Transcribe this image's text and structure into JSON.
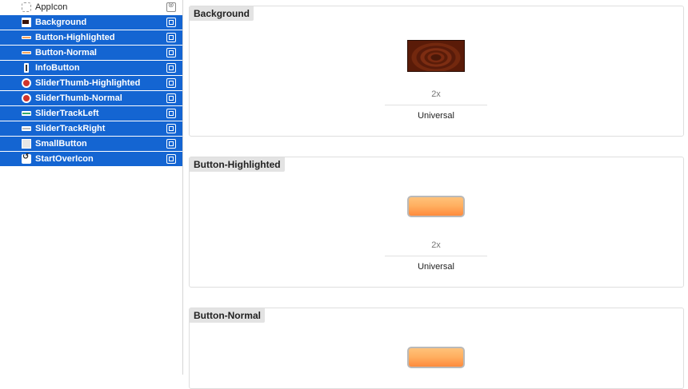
{
  "sidebar": {
    "items": [
      {
        "label": "AppIcon",
        "icon": "app-icon-placeholder",
        "selected": false
      },
      {
        "label": "Background",
        "icon": "background-image-icon",
        "selected": true
      },
      {
        "label": "Button-Highlighted",
        "icon": "button-image-icon",
        "selected": true
      },
      {
        "label": "Button-Normal",
        "icon": "button-image-icon",
        "selected": true
      },
      {
        "label": "InfoButton",
        "icon": "info-button-icon",
        "selected": true
      },
      {
        "label": "SliderThumb-Highlighted",
        "icon": "slider-thumb-icon",
        "selected": true
      },
      {
        "label": "SliderThumb-Normal",
        "icon": "slider-thumb-icon",
        "selected": true
      },
      {
        "label": "SliderTrackLeft",
        "icon": "slider-track-icon",
        "selected": true
      },
      {
        "label": "SliderTrackRight",
        "icon": "slider-track-icon",
        "selected": true
      },
      {
        "label": "SmallButton",
        "icon": "small-button-icon",
        "selected": true
      },
      {
        "label": "StartOverIcon",
        "icon": "start-over-icon",
        "selected": true
      }
    ]
  },
  "main": {
    "sets": [
      {
        "title": "Background",
        "scale": "2x",
        "idiom": "Universal"
      },
      {
        "title": "Button-Highlighted",
        "scale": "2x",
        "idiom": "Universal"
      },
      {
        "title": "Button-Normal",
        "scale": "",
        "idiom": ""
      }
    ]
  },
  "colors": {
    "selection": "#1465d2",
    "background_image": "#5a1c08",
    "button_image": "#ff9a4a"
  }
}
